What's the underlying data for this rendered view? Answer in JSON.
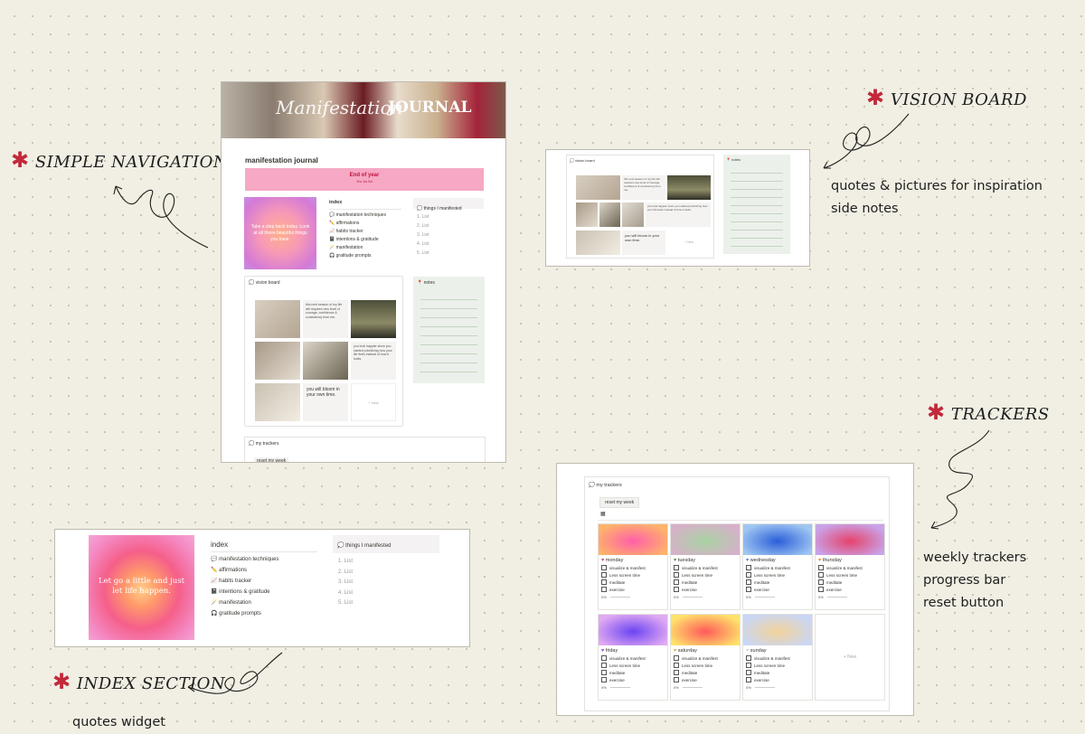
{
  "annotations": {
    "nav": "SIMPLE NAVIGATION",
    "vision": "VISION BOARD",
    "vision_notes": [
      "quotes & pictures for inspiration",
      "side notes"
    ],
    "trackers": "TRACKERS",
    "tracker_notes": [
      "weekly trackers",
      "progress bar",
      "reset button"
    ],
    "index": "INDEX SECTION",
    "index_notes": [
      "quotes widget"
    ]
  },
  "journal": {
    "banner_script": "Manifestation",
    "banner_title": "JOURNAL",
    "page_title": "manifestation journal",
    "countdown_title": "End of year",
    "countdown_value": "3m 1w 5d",
    "quote_small": "Take a step back today. Look at all those beautiful things you have."
  },
  "index": {
    "heading": "index",
    "items": [
      "manifestation techniques",
      "affirmations",
      "habits tracker",
      "intentions & gratitude",
      "manifestation",
      "gratitude prompts"
    ],
    "quote": "Let go a little and just let life happen."
  },
  "manifested": {
    "heading": "things I manifested",
    "numbers": [
      "1.",
      "2.",
      "3.",
      "4.",
      "5."
    ],
    "placeholder": "List"
  },
  "vision_board": {
    "heading": "vision board",
    "quote1": "this next season of my life will requires new level of courage, confidence & consistency from me.",
    "quote2": "you look happier since you started prioritizing how your life feels instead of how it looks.",
    "quote3": "you will bloom in your own time.",
    "new": "+ New"
  },
  "notes": {
    "heading": "notes"
  },
  "trackers": {
    "heading": "my trackers",
    "reset_button": "reset my week",
    "tasks": [
      "visualize & manifest",
      "Less screen time",
      "meditate",
      "exercise"
    ],
    "progress": "0%",
    "new": "+ New",
    "days": [
      {
        "name": "monday",
        "heart": "#d0446a",
        "colors": [
          "#ff5fa8",
          "#ffb36b"
        ]
      },
      {
        "name": "tuesday",
        "heart": "#5d8a3c",
        "colors": [
          "#a8d3a2",
          "#d6b1c9"
        ]
      },
      {
        "name": "wednesday",
        "heart": "#4a7fd0",
        "colors": [
          "#2b5ed8",
          "#9fc6f2"
        ]
      },
      {
        "name": "thursday",
        "heart": "#ef8a1f",
        "colors": [
          "#e6436b",
          "#c9a3e8"
        ]
      },
      {
        "name": "friday",
        "heart": "#8a45d6",
        "colors": [
          "#6b44f2",
          "#e1a9f2"
        ]
      },
      {
        "name": "saturday",
        "heart": "#e7a42b",
        "colors": [
          "#ff5a5a",
          "#ffe26b"
        ]
      },
      {
        "name": "sunday",
        "heart": "#d9d2dd",
        "colors": [
          "#f2d39a",
          "#c9d6f4"
        ]
      }
    ]
  },
  "colors": {
    "accent": "#c2283a",
    "countdown": "#f6a8c4",
    "notes_bg": "#ebf1ea"
  }
}
